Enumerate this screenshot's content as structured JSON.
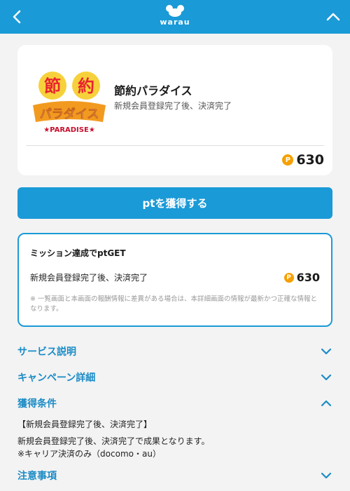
{
  "header": {
    "logo_text": "warau",
    "back_icon": "chevron-left-icon",
    "collapse_icon": "chevron-up-icon",
    "bg_color": "#1a9ad7"
  },
  "offer": {
    "thumbnail_text_top": "節約",
    "thumbnail_text_main": "パラダイス",
    "thumbnail_text_sub": "★PARADISE★",
    "title": "節約パラダイス",
    "subtitle": "新規会員登録完了後、決済完了",
    "points": "630",
    "coin_letter": "P"
  },
  "cta": {
    "label": "ptを獲得する"
  },
  "mission": {
    "title": "ミッション達成でptGET",
    "condition": "新規会員登録完了後、決済完了",
    "points": "630",
    "coin_letter": "P",
    "note": "※ 一覧画面と本画面の報酬情報に差異がある場合は、本詳細画面の情報が最新かつ正確な情報となります。"
  },
  "accordions": {
    "service": {
      "label": "サービス説明",
      "state": "collapsed"
    },
    "campaign": {
      "label": "キャンペーン詳細",
      "state": "collapsed"
    },
    "conditions": {
      "label": "獲得条件",
      "state": "expanded",
      "line1": "【新規会員登録完了後、決済完了】",
      "line2": "新規会員登録完了後、決済完了で成果となります。",
      "line3": "※キャリア決済のみ（docomo・au）"
    },
    "notes": {
      "label": "注意事項",
      "state": "collapsed"
    }
  },
  "colors": {
    "accent": "#1a9ad7",
    "link": "#1a8bc6",
    "coin": "#f5a000"
  }
}
